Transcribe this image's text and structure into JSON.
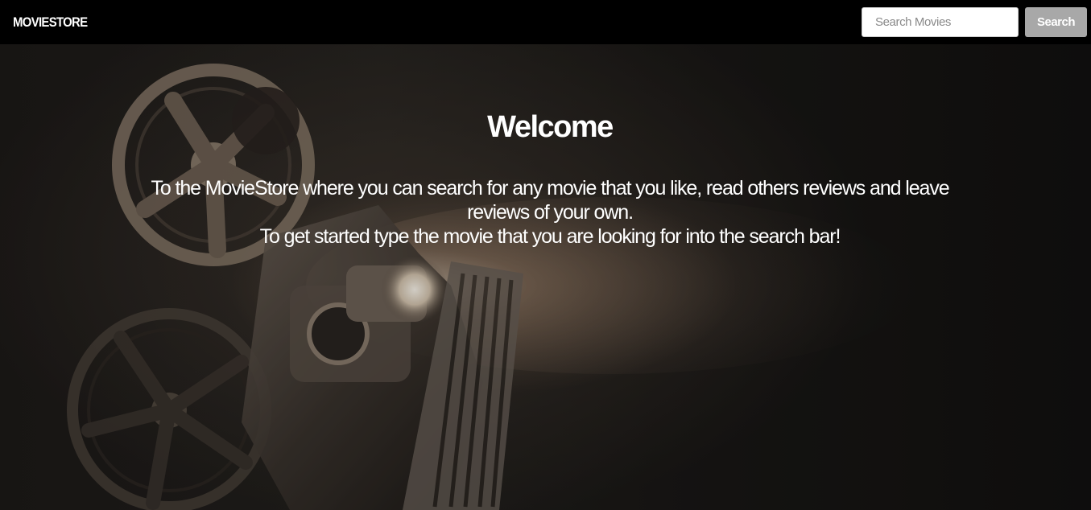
{
  "navbar": {
    "brand": "MOVIESTORE",
    "search": {
      "placeholder": "Search Movies",
      "value": "",
      "button_label": "Search"
    }
  },
  "hero": {
    "title": "Welcome",
    "lines": [
      "To the MovieStore where you can search for any movie that you like, read others reviews and leave reviews of your own.",
      "To get started type the movie that you are looking for into the search bar!"
    ],
    "background_image": "film-projector-image"
  },
  "colors": {
    "navbar_bg": "#000000",
    "search_button_bg": "#a8a8a8",
    "text": "#ffffff"
  }
}
